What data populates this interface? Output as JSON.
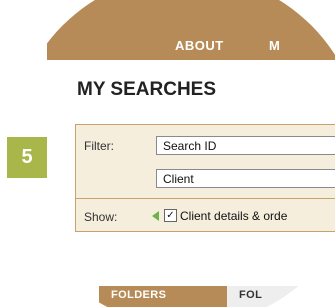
{
  "step": {
    "number": "5"
  },
  "nav": {
    "items": [
      "ABOUT",
      "M"
    ]
  },
  "page": {
    "title": "MY SEARCHES"
  },
  "filter": {
    "label": "Filter:",
    "fields": [
      {
        "value": "Search ID"
      },
      {
        "value": "Client"
      }
    ]
  },
  "show": {
    "label": "Show:",
    "checkbox_label": "Client details & orde",
    "checked": true,
    "check_mark": "✓"
  },
  "tabs": [
    {
      "label": "FOLDERS",
      "active": true
    },
    {
      "label": "FOL",
      "active": false
    }
  ],
  "colors": {
    "accent": "#b68b57",
    "badge": "#a8b64a",
    "panel_bg": "#f5eedd",
    "arrow": "#6fb24a"
  }
}
